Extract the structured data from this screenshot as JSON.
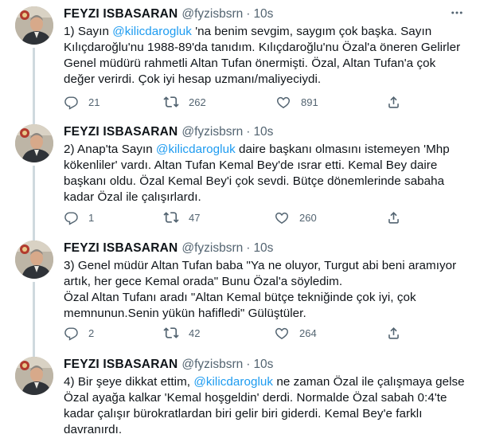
{
  "tweets": [
    {
      "name": "FEYZI ISBASARAN",
      "handle": "@fyzisbsrn",
      "time": "10s",
      "text_pre": "1) Sayın ",
      "mention": "@kilicdarogluk",
      "text_post": " 'na benim sevgim, saygım çok başka. Sayın Kılıçdaroğlu'nu 1988-89'da tanıdım. Kılıçdaroğlu'nu Özal'a öneren Gelirler Genel müdürü rahmetli Altan Tufan önermişti. Özal, Altan Tufan'a çok değer verirdi. Çok iyi hesap uzmanı/maliyeciydi.",
      "replies": "21",
      "retweets": "262",
      "likes": "891"
    },
    {
      "name": "FEYZI ISBASARAN",
      "handle": "@fyzisbsrn",
      "time": "10s",
      "text_pre": "2) Anap'ta Sayın ",
      "mention": "@kilicdarogluk",
      "text_post": " daire başkanı olmasını istemeyen 'Mhp kökenliler' vardı. Altan Tufan Kemal Bey'de ısrar etti. Kemal Bey daire başkanı oldu. Özal Kemal Bey'i çok sevdi. Bütçe dönemlerinde sabaha kadar Özal ile çalışırlardı.",
      "replies": "1",
      "retweets": "47",
      "likes": "260"
    },
    {
      "name": "FEYZI ISBASARAN",
      "handle": "@fyzisbsrn",
      "time": "10s",
      "text_pre": "3) Genel müdür Altan Tufan baba \"Ya ne oluyor, Turgut abi beni aramıyor artık, her gece Kemal orada\" Bunu Özal'a söyledim.\nÖzal Altan Tufanı aradı \"Altan Kemal bütçe tekniğinde çok iyi, çok memnunun.Senin yükün hafifledi\" Gülüştüler.",
      "mention": "",
      "text_post": "",
      "replies": "2",
      "retweets": "42",
      "likes": "264"
    },
    {
      "name": "FEYZI ISBASARAN",
      "handle": "@fyzisbsrn",
      "time": "10s",
      "text_pre": "4) Bir şeye dikkat ettim, ",
      "mention": "@kilicdarogluk",
      "text_post": " ne zaman Özal ile çalışmaya gelse Özal ayağa kalkar 'Kemal hoşgeldin' derdi. Normalde Özal sabah 0:4'te kadar çalışır bürokratlardan biri gelir biri giderdi. Kemal Bey'e farklı davranırdı.",
      "replies": "",
      "retweets": "",
      "likes": ""
    }
  ],
  "colors": {
    "accent": "#1d9bf0",
    "text": "#0f1419",
    "muted": "#536471",
    "thread_line": "#cfd9de"
  },
  "icons": {
    "more": "more-horizontal-icon",
    "reply": "reply-icon",
    "retweet": "retweet-icon",
    "like": "heart-icon",
    "share": "share-icon"
  }
}
